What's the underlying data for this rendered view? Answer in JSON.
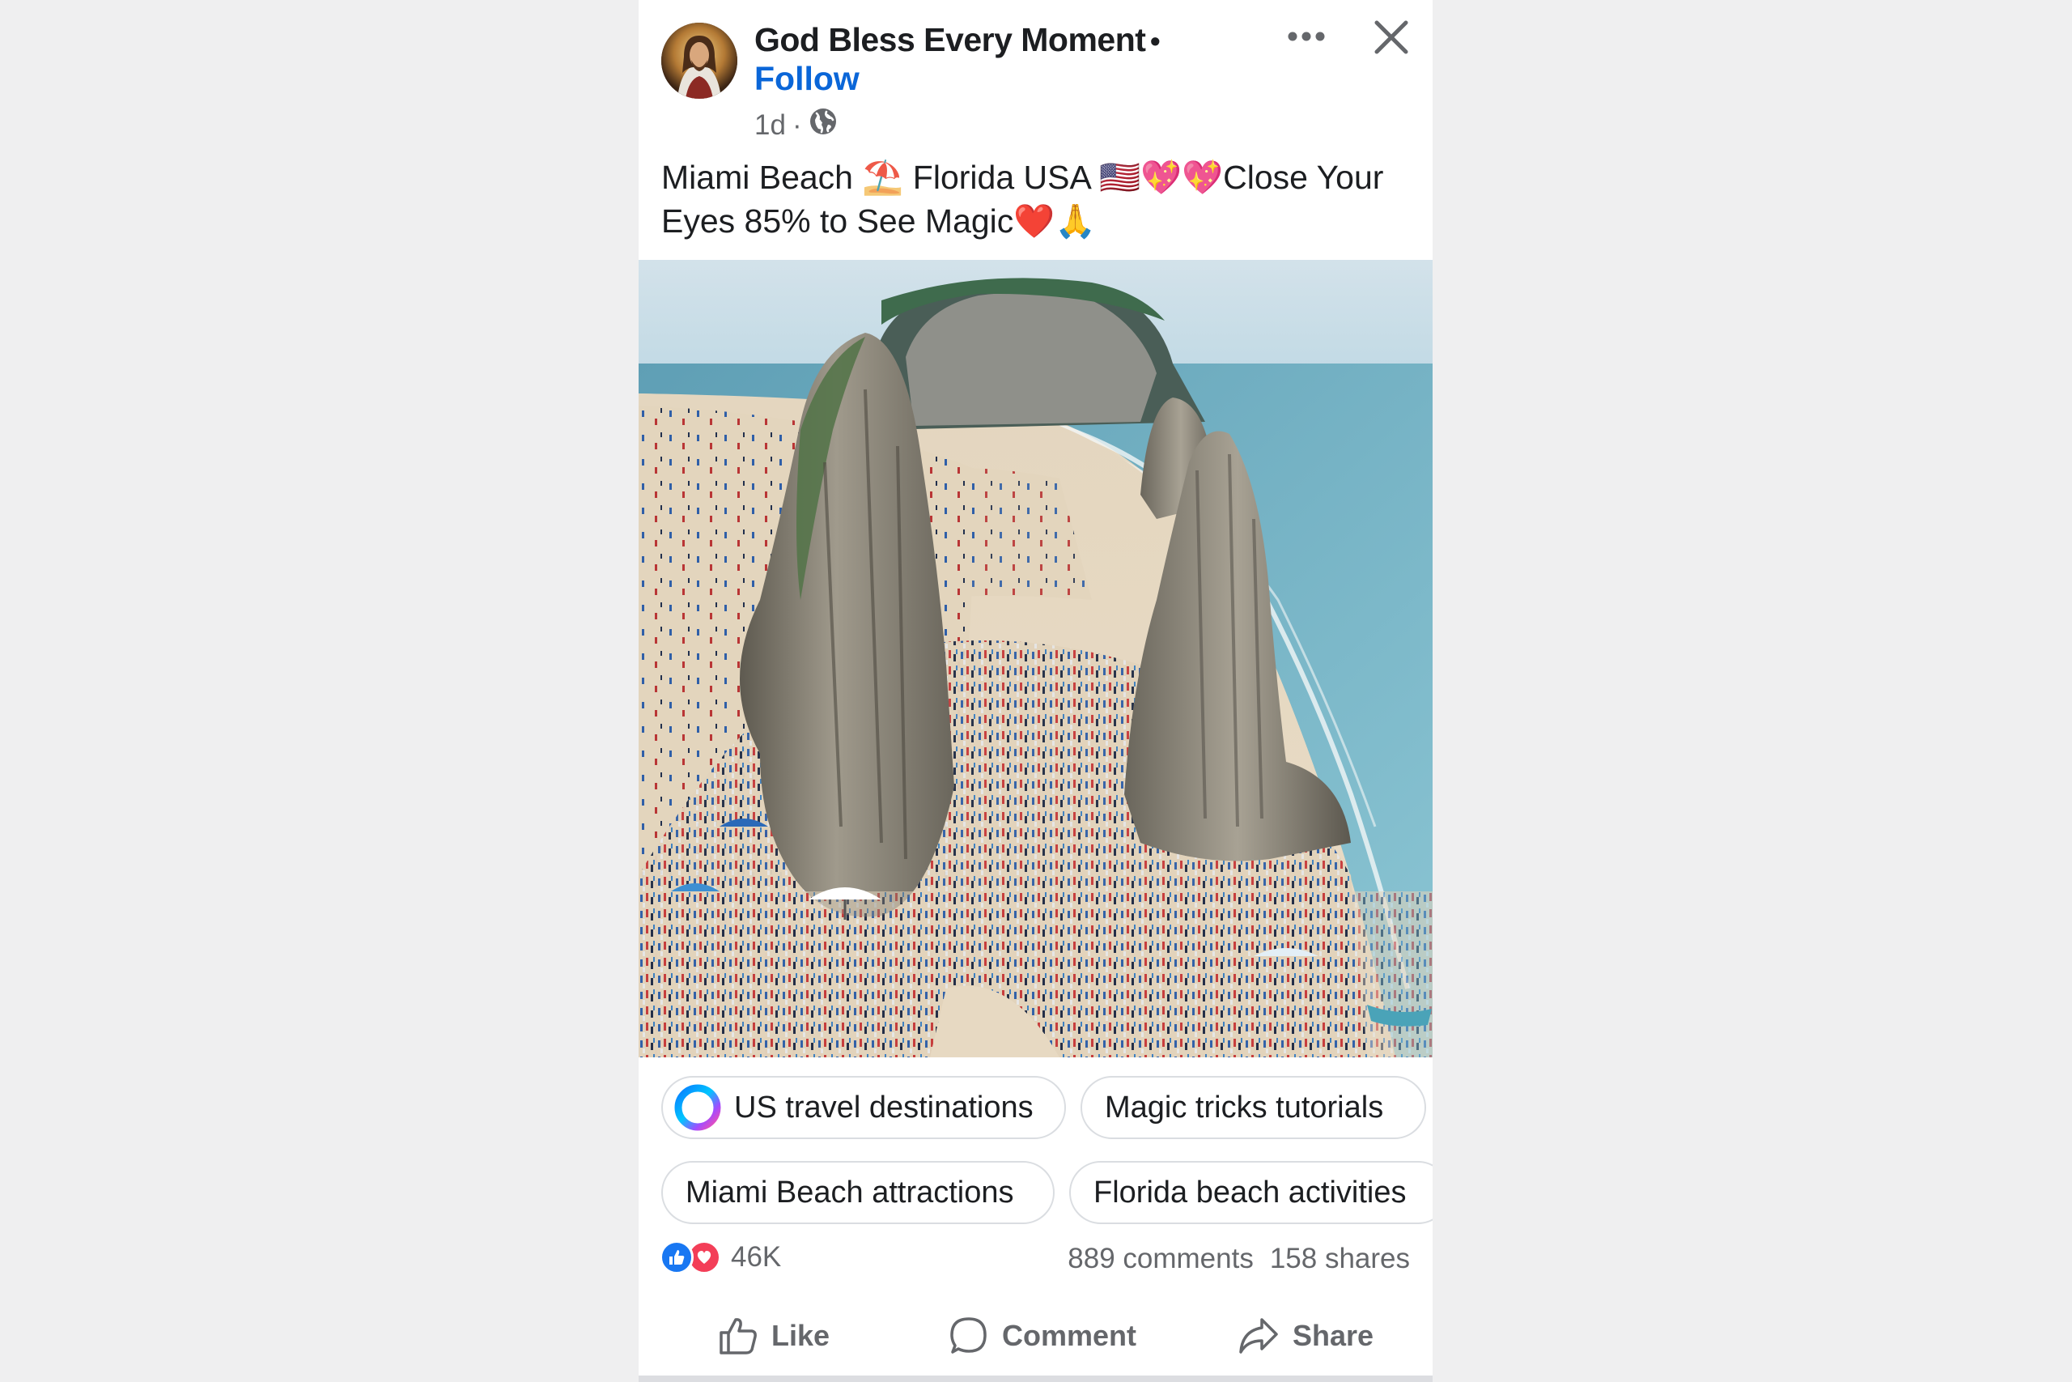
{
  "post": {
    "page_name": "God Bless Every Moment",
    "separator": "•",
    "follow_label": "Follow",
    "time": "1d",
    "meta_sep": "·",
    "privacy_icon": "globe-icon",
    "caption_line1": "Miami Beach ⛱️ Florida USA 🇺🇸💖💖Close Your",
    "caption_line2": "Eyes 85% to See Magic❤️🙏"
  },
  "suggestions": [
    {
      "label": "US travel destinations",
      "icon": "meta-ai-ring-icon"
    },
    {
      "label": "Magic tricks tutorials"
    },
    {
      "label": "Miami Beach attractions"
    },
    {
      "label": "Florida beach activities"
    }
  ],
  "stats": {
    "reaction_count": "46K",
    "comments": "889 comments",
    "shares": "158 shares"
  },
  "actions": {
    "like": "Like",
    "comment": "Comment",
    "share": "Share"
  },
  "colors": {
    "link_blue": "#0a66d8",
    "like_blue": "#1877f2",
    "love_red": "#f33e58",
    "secondary_text": "#65676b"
  }
}
